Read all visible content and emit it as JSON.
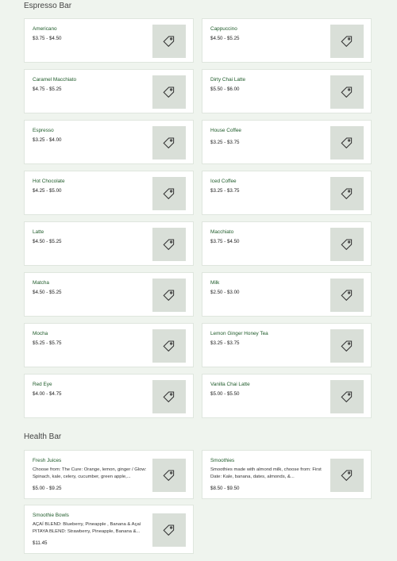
{
  "espresso_bar": {
    "title": "Espresso Bar",
    "items": [
      {
        "name": "Americano",
        "price": "$3.75 - $4.50"
      },
      {
        "name": "Cappuccino",
        "price": "$4.50 - $5.25"
      },
      {
        "name": "Caramel Macchiato",
        "price": "$4.75 - $5.25"
      },
      {
        "name": "Dirty Chai Latte",
        "price": "$5.50 - $6.00"
      },
      {
        "name": "Espresso",
        "price": "$3.25 - $4.00"
      },
      {
        "name": "House Coffee",
        "price": "$3.25 - $3.75"
      },
      {
        "name": "Hot Chocolate",
        "price": "$4.25 - $5.00"
      },
      {
        "name": "Iced Coffee",
        "price": "$3.25 - $3.75"
      },
      {
        "name": "Latte",
        "price": "$4.50 - $5.25"
      },
      {
        "name": "Macchiato",
        "price": "$3.75 - $4.50"
      },
      {
        "name": "Matcha",
        "price": "$4.50 - $5.25"
      },
      {
        "name": "Milk",
        "price": "$2.50 - $3.00"
      },
      {
        "name": "Mocha",
        "price": "$5.25 - $5.75"
      },
      {
        "name": "Lemon Ginger Honey Tea",
        "price": "$3.25 - $3.75"
      },
      {
        "name": "Red Eye",
        "price": "$4.00 - $4.75"
      },
      {
        "name": "Vanilla Chai Latte",
        "price": "$5.00 - $5.50"
      }
    ]
  },
  "health_bar": {
    "title": "Health Bar",
    "items": [
      {
        "name": "Fresh Juices",
        "description": "Choose from: The Cure: Orange, lemon, ginger / Glow: Spinach, kale, celery, cucumber, green apple,...",
        "price": "$5.00 - $9.25"
      },
      {
        "name": "Smoothies",
        "description": "Smoothies made with almond milk, choose from: First Date: Kale, banana, dates, almonds, &...",
        "price": "$8.50 - $9.50"
      },
      {
        "name": "Smoothie Bowls",
        "description": "AÇAÍ BLEND: Blueberry, Pineapple , Banana & Açaí PITAYA BLEND: Strawberry, Pineapple, Banana &...",
        "price": "$11.45"
      }
    ]
  },
  "icons": {
    "item_thumbnail": "tag-icon"
  }
}
